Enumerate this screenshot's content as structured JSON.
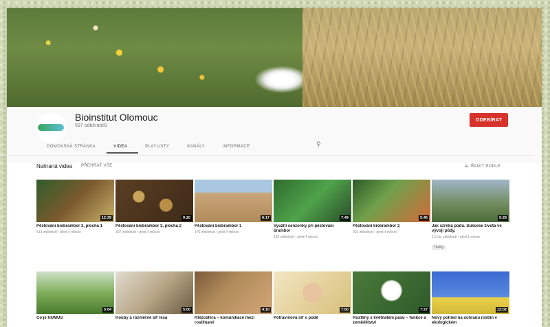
{
  "channel": {
    "name": "Bioinstitut Olomouc",
    "subscribers": "597 odběratelů",
    "subscribe_label": "ODEBÍRAT"
  },
  "tabs": [
    {
      "label": "DOMOVSKÁ STRÁNKA"
    },
    {
      "label": "VIDEA"
    },
    {
      "label": "PLAYLISTY"
    },
    {
      "label": "KANÁLY"
    },
    {
      "label": "INFORMACE"
    }
  ],
  "search_icon": "search-icon",
  "section": {
    "title": "Nahraná videa",
    "play_all": "PŘEHRÁT VŠE",
    "sort_label": "ŘADIT PODLE",
    "sort_icon": "sort-icon"
  },
  "videos": [
    {
      "title": "Pěstování biobrambor 3, plocha 1",
      "meta": "513 zhlédnutí • před 4 měsíci",
      "duration": "12:39"
    },
    {
      "title": "Pěstování biobrambor 3, plocha 2",
      "meta": "307 zhlédnutí • před 4 měsíci",
      "duration": "9:20"
    },
    {
      "title": "Pěstování biobrambor 1",
      "meta": "176 zhlédnutí • před 4 měsíci",
      "duration": "6:17"
    },
    {
      "title": "Využití senzoriky při pěstování brambor",
      "meta": "136 zhlédnutí • před 4 měsíci",
      "duration": "7:49"
    },
    {
      "title": "Pěstování biobrambor 2",
      "meta": "301 zhlédnutí • před 4 měsíci",
      "duration": "5:46"
    },
    {
      "title": "Jak szrnká půdu. Sukcese života ve vývoji půdy.",
      "meta": "1,6 tis. zhlédnutí • před 1 rokem",
      "duration": "5:28",
      "badge": "Titulky"
    },
    {
      "title": "Co je HUMUS",
      "meta": "",
      "duration": "5:04"
    },
    {
      "title": "Houby a rozměrné síť lesa",
      "meta": "",
      "duration": "5:00"
    },
    {
      "title": "Rhizosféra – komunikace mezi rostlinami",
      "meta": "",
      "duration": "4:10"
    },
    {
      "title": "Potravinová síť v půdě",
      "meta": "",
      "duration": "7:00"
    },
    {
      "title": "Rostliny s květnatém pásu – funkce a zemědělství",
      "meta": "",
      "duration": "7:27"
    },
    {
      "title": "Nový pohled na ochranu rostlin v ekologickém",
      "meta": "",
      "duration": "12:02"
    }
  ]
}
